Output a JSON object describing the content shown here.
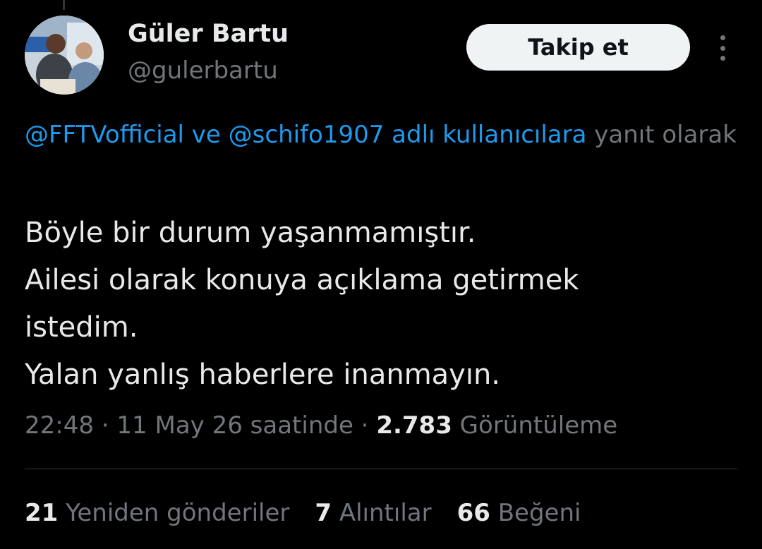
{
  "author": {
    "display_name": "Güler Bartu",
    "handle": "@gulerbartu"
  },
  "follow_button_label": "Takip et",
  "reply_context": {
    "mention_1": "@FFTVofficial",
    "joiner": " ve ",
    "mention_2": "@schifo1907",
    "suffix_linked": " adlı kullanıcılara",
    "suffix_plain": " yanıt olarak"
  },
  "tweet_lines": [
    "Böyle bir durum yaşanmamıştır.",
    "Ailesi olarak konuya açıklama getirmek",
    "istedim.",
    "Yalan yanlış haberlere inanmayın."
  ],
  "meta": {
    "time": "22:48",
    "sep1": " · ",
    "date": "11 May 26 saatinde",
    "sep2": " · ",
    "views_count": "2.783",
    "views_label": " Görüntüleme"
  },
  "stats": [
    {
      "count": "21",
      "label": " Yeniden gönderiler"
    },
    {
      "count": "7",
      "label": " Alıntılar"
    },
    {
      "count": "66",
      "label": " Beğeni"
    }
  ],
  "colors": {
    "background": "#000000",
    "text_primary": "#e7e9ea",
    "text_secondary": "#71767b",
    "link": "#1d9bf0",
    "button_bg": "#eff3f4"
  },
  "icons": {
    "more": "vertical-ellipsis-icon"
  }
}
